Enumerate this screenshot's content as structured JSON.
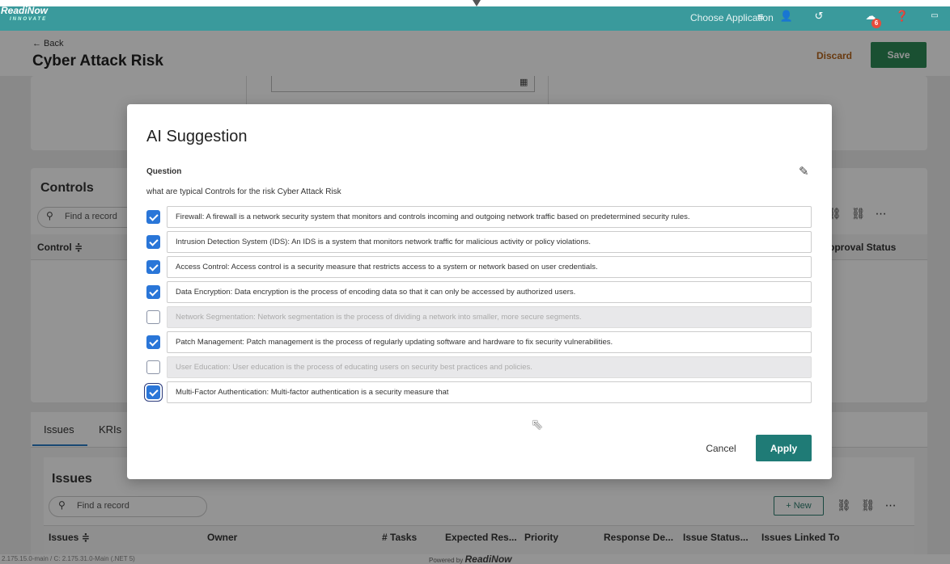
{
  "app": {
    "logo_main": "ReadiNow",
    "logo_sub": "INNOVATE",
    "choose_application": "Choose Application",
    "notification_count": "6"
  },
  "icons": {
    "menu": "hamburger-icon",
    "user": "user-icon",
    "history": "history-icon",
    "notifications": "bell-icon",
    "help": "help-icon",
    "more": "window-icon",
    "calendar": "calendar-icon",
    "edit": "edit-icon",
    "search": "search-icon",
    "link": "link-icon",
    "unlink": "unlink-icon"
  },
  "header": {
    "back": "← Back",
    "title": "Cyber Attack Risk",
    "discard": "Discard",
    "save": "Save"
  },
  "background": {
    "controls_title": "Controls",
    "find_record": "Find a record",
    "control_col": "Control ≑",
    "approval_col": "pproval Status",
    "tab_issues": "Issues",
    "tab_kris": "KRIs",
    "issues_title": "Issues",
    "new_button": "+ New",
    "issues_columns": [
      "Issues ≑",
      "Owner",
      "# Tasks",
      "Expected Res...",
      "Priority",
      "Response De...",
      "Issue Status...",
      "Issues Linked To"
    ]
  },
  "modal": {
    "title": "AI Suggestion",
    "question_label": "Question",
    "question_text": "what are typical Controls for the risk Cyber Attack Risk",
    "suggestions": [
      {
        "text": "Firewall: A firewall is a network security system that monitors and controls incoming and outgoing network traffic based on predetermined security rules.",
        "checked": true
      },
      {
        "text": "Intrusion Detection System (IDS): An IDS is a system that monitors network traffic for malicious activity or policy violations.",
        "checked": true
      },
      {
        "text": "Access Control: Access control is a security measure that restricts access to a system or network based on user credentials.",
        "checked": true
      },
      {
        "text": "Data Encryption: Data encryption is the process of encoding data so that it can only be accessed by authorized users.",
        "checked": true
      },
      {
        "text": "Network Segmentation: Network segmentation is the process of dividing a network into smaller, more secure segments.",
        "checked": false
      },
      {
        "text": "Patch Management: Patch management is the process of regularly updating software and hardware to fix security vulnerabilities.",
        "checked": true
      },
      {
        "text": "User Education: User education is the process of educating users on security best practices and policies.",
        "checked": false
      },
      {
        "text": "Multi-Factor Authentication: Multi-factor authentication is a security measure that",
        "checked": true
      }
    ],
    "cancel": "Cancel",
    "apply": "Apply"
  },
  "footer": {
    "version": "2.175.15.0-main / C: 2.175.31.0-Main (.NET 5)",
    "powered_by": "Powered by",
    "brand": "ReadiNow"
  },
  "colors": {
    "topbar": "#3a9a9c",
    "save": "#2e8b57",
    "apply": "#1f7b76",
    "checkbox": "#2a76d8",
    "discard": "#b5651d"
  }
}
